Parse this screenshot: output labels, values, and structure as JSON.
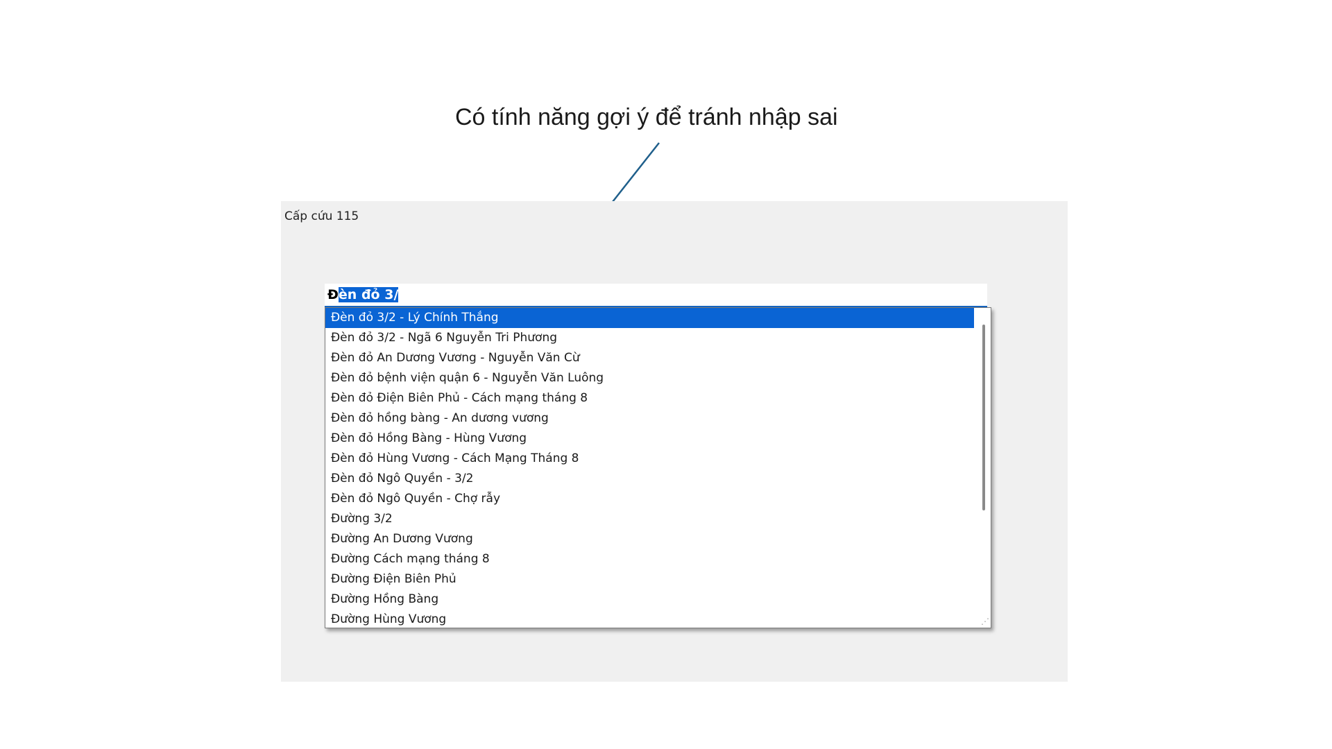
{
  "annotation": {
    "text": "Có tính năng gợi ý để tránh nhập sai"
  },
  "form": {
    "title": "Cấp cứu 115"
  },
  "combo": {
    "typed_text": "Đ",
    "suggested_text": "èn đỏ 3/"
  },
  "dropdown": {
    "items": [
      {
        "label": "Đèn đỏ 3/2 - Lý Chính Thắng",
        "selected": true
      },
      {
        "label": "Đèn đỏ 3/2 - Ngã 6 Nguyễn Tri Phương",
        "selected": false
      },
      {
        "label": "Đèn đỏ An Dương Vương - Nguyễn Văn Cừ",
        "selected": false
      },
      {
        "label": "Đèn đỏ bệnh viện quận 6 - Nguyễn Văn Luông",
        "selected": false
      },
      {
        "label": "Đèn đỏ Điện Biên Phủ - Cách mạng tháng 8",
        "selected": false
      },
      {
        "label": "Đèn đỏ hồng bàng - An dương vương",
        "selected": false
      },
      {
        "label": "Đèn đỏ Hồng Bàng - Hùng Vương",
        "selected": false
      },
      {
        "label": "Đèn đỏ Hùng Vương - Cách Mạng Tháng 8",
        "selected": false
      },
      {
        "label": "Đèn đỏ Ngô Quyền - 3/2",
        "selected": false
      },
      {
        "label": "Đèn đỏ Ngô Quyền - Chợ rẫy",
        "selected": false
      },
      {
        "label": "Đường 3/2",
        "selected": false
      },
      {
        "label": "Đường An Dương Vương",
        "selected": false
      },
      {
        "label": "Đường Cách mạng tháng 8",
        "selected": false
      },
      {
        "label": "Đường Điện Biên Phủ",
        "selected": false
      },
      {
        "label": "Đường Hồng Bàng",
        "selected": false
      },
      {
        "label": "Đường Hùng Vương",
        "selected": false
      }
    ]
  },
  "colors": {
    "selection": "#0a64d4",
    "arrow": "#1f5f8b",
    "panel_background": "#f0f0f0"
  },
  "icons": {
    "resize_grip": "resize-grip-icon"
  }
}
